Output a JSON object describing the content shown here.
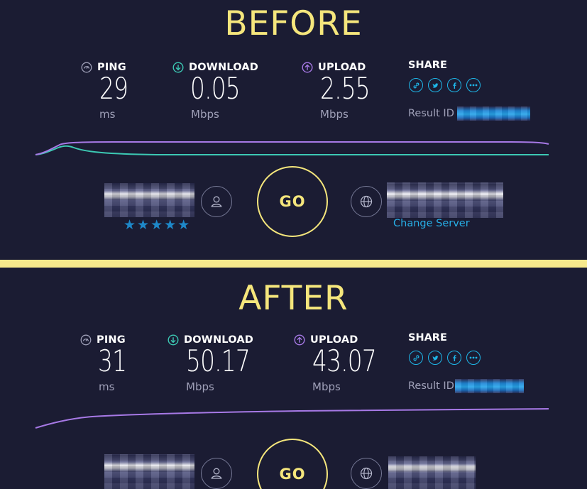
{
  "colors": {
    "background": "#1b1c33",
    "heading": "#f5e67c",
    "divider": "#f7e98c",
    "download_line": "#3cc9b4",
    "upload_line": "#a779e6",
    "accent": "#1eb6e8"
  },
  "before": {
    "heading": "BEFORE",
    "ping": {
      "label": "PING",
      "value": "29",
      "unit": "ms",
      "icon": "ping-gauge-icon"
    },
    "download": {
      "label": "DOWNLOAD",
      "value": "0.05",
      "unit": "Mbps",
      "icon": "download-arrow-icon"
    },
    "upload": {
      "label": "UPLOAD",
      "value": "2.55",
      "unit": "Mbps",
      "icon": "upload-arrow-icon"
    },
    "share": {
      "label": "SHARE",
      "icons": [
        "link-icon",
        "twitter-icon",
        "facebook-icon",
        "more-icon"
      ],
      "result_label": "Result ID"
    },
    "go_label": "GO",
    "rating_stars": "★★★★★",
    "change_server_label": "Change Server"
  },
  "after": {
    "heading": "AFTER",
    "ping": {
      "label": "PING",
      "value": "31",
      "unit": "ms",
      "icon": "ping-gauge-icon"
    },
    "download": {
      "label": "DOWNLOAD",
      "value": "50.17",
      "unit": "Mbps",
      "icon": "download-arrow-icon"
    },
    "upload": {
      "label": "UPLOAD",
      "value": "43.07",
      "unit": "Mbps",
      "icon": "upload-arrow-icon"
    },
    "share": {
      "label": "SHARE",
      "icons": [
        "link-icon",
        "twitter-icon",
        "facebook-icon",
        "more-icon"
      ],
      "result_label": "Result ID"
    },
    "go_label": "GO"
  }
}
